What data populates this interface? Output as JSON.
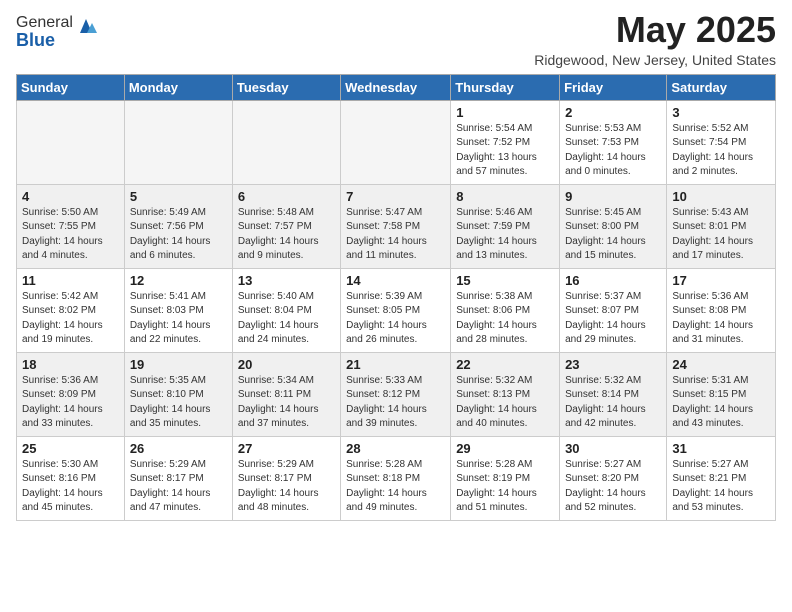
{
  "header": {
    "logo_line1": "General",
    "logo_line2": "Blue",
    "month": "May 2025",
    "location": "Ridgewood, New Jersey, United States"
  },
  "weekdays": [
    "Sunday",
    "Monday",
    "Tuesday",
    "Wednesday",
    "Thursday",
    "Friday",
    "Saturday"
  ],
  "weeks": [
    [
      {
        "day": "",
        "info": ""
      },
      {
        "day": "",
        "info": ""
      },
      {
        "day": "",
        "info": ""
      },
      {
        "day": "",
        "info": ""
      },
      {
        "day": "1",
        "info": "Sunrise: 5:54 AM\nSunset: 7:52 PM\nDaylight: 13 hours\nand 57 minutes."
      },
      {
        "day": "2",
        "info": "Sunrise: 5:53 AM\nSunset: 7:53 PM\nDaylight: 14 hours\nand 0 minutes."
      },
      {
        "day": "3",
        "info": "Sunrise: 5:52 AM\nSunset: 7:54 PM\nDaylight: 14 hours\nand 2 minutes."
      }
    ],
    [
      {
        "day": "4",
        "info": "Sunrise: 5:50 AM\nSunset: 7:55 PM\nDaylight: 14 hours\nand 4 minutes."
      },
      {
        "day": "5",
        "info": "Sunrise: 5:49 AM\nSunset: 7:56 PM\nDaylight: 14 hours\nand 6 minutes."
      },
      {
        "day": "6",
        "info": "Sunrise: 5:48 AM\nSunset: 7:57 PM\nDaylight: 14 hours\nand 9 minutes."
      },
      {
        "day": "7",
        "info": "Sunrise: 5:47 AM\nSunset: 7:58 PM\nDaylight: 14 hours\nand 11 minutes."
      },
      {
        "day": "8",
        "info": "Sunrise: 5:46 AM\nSunset: 7:59 PM\nDaylight: 14 hours\nand 13 minutes."
      },
      {
        "day": "9",
        "info": "Sunrise: 5:45 AM\nSunset: 8:00 PM\nDaylight: 14 hours\nand 15 minutes."
      },
      {
        "day": "10",
        "info": "Sunrise: 5:43 AM\nSunset: 8:01 PM\nDaylight: 14 hours\nand 17 minutes."
      }
    ],
    [
      {
        "day": "11",
        "info": "Sunrise: 5:42 AM\nSunset: 8:02 PM\nDaylight: 14 hours\nand 19 minutes."
      },
      {
        "day": "12",
        "info": "Sunrise: 5:41 AM\nSunset: 8:03 PM\nDaylight: 14 hours\nand 22 minutes."
      },
      {
        "day": "13",
        "info": "Sunrise: 5:40 AM\nSunset: 8:04 PM\nDaylight: 14 hours\nand 24 minutes."
      },
      {
        "day": "14",
        "info": "Sunrise: 5:39 AM\nSunset: 8:05 PM\nDaylight: 14 hours\nand 26 minutes."
      },
      {
        "day": "15",
        "info": "Sunrise: 5:38 AM\nSunset: 8:06 PM\nDaylight: 14 hours\nand 28 minutes."
      },
      {
        "day": "16",
        "info": "Sunrise: 5:37 AM\nSunset: 8:07 PM\nDaylight: 14 hours\nand 29 minutes."
      },
      {
        "day": "17",
        "info": "Sunrise: 5:36 AM\nSunset: 8:08 PM\nDaylight: 14 hours\nand 31 minutes."
      }
    ],
    [
      {
        "day": "18",
        "info": "Sunrise: 5:36 AM\nSunset: 8:09 PM\nDaylight: 14 hours\nand 33 minutes."
      },
      {
        "day": "19",
        "info": "Sunrise: 5:35 AM\nSunset: 8:10 PM\nDaylight: 14 hours\nand 35 minutes."
      },
      {
        "day": "20",
        "info": "Sunrise: 5:34 AM\nSunset: 8:11 PM\nDaylight: 14 hours\nand 37 minutes."
      },
      {
        "day": "21",
        "info": "Sunrise: 5:33 AM\nSunset: 8:12 PM\nDaylight: 14 hours\nand 39 minutes."
      },
      {
        "day": "22",
        "info": "Sunrise: 5:32 AM\nSunset: 8:13 PM\nDaylight: 14 hours\nand 40 minutes."
      },
      {
        "day": "23",
        "info": "Sunrise: 5:32 AM\nSunset: 8:14 PM\nDaylight: 14 hours\nand 42 minutes."
      },
      {
        "day": "24",
        "info": "Sunrise: 5:31 AM\nSunset: 8:15 PM\nDaylight: 14 hours\nand 43 minutes."
      }
    ],
    [
      {
        "day": "25",
        "info": "Sunrise: 5:30 AM\nSunset: 8:16 PM\nDaylight: 14 hours\nand 45 minutes."
      },
      {
        "day": "26",
        "info": "Sunrise: 5:29 AM\nSunset: 8:17 PM\nDaylight: 14 hours\nand 47 minutes."
      },
      {
        "day": "27",
        "info": "Sunrise: 5:29 AM\nSunset: 8:17 PM\nDaylight: 14 hours\nand 48 minutes."
      },
      {
        "day": "28",
        "info": "Sunrise: 5:28 AM\nSunset: 8:18 PM\nDaylight: 14 hours\nand 49 minutes."
      },
      {
        "day": "29",
        "info": "Sunrise: 5:28 AM\nSunset: 8:19 PM\nDaylight: 14 hours\nand 51 minutes."
      },
      {
        "day": "30",
        "info": "Sunrise: 5:27 AM\nSunset: 8:20 PM\nDaylight: 14 hours\nand 52 minutes."
      },
      {
        "day": "31",
        "info": "Sunrise: 5:27 AM\nSunset: 8:21 PM\nDaylight: 14 hours\nand 53 minutes."
      }
    ]
  ]
}
